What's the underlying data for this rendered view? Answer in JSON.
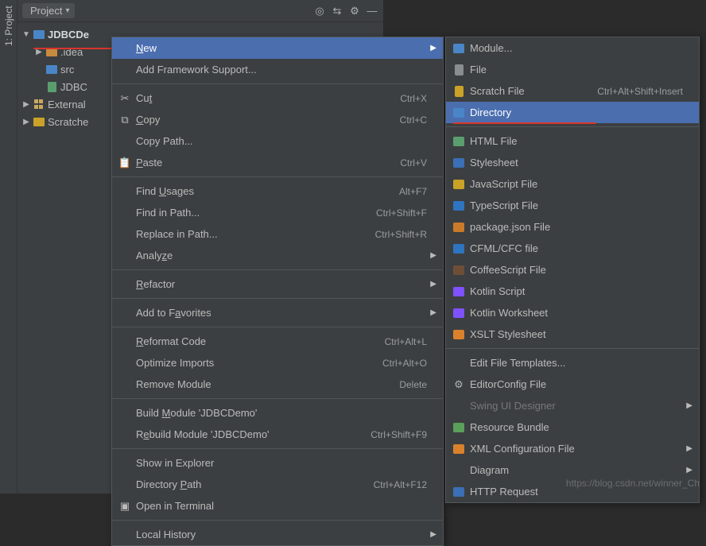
{
  "sidebar": {
    "tab_label": "1: Project"
  },
  "panel": {
    "title": "Project",
    "tree": {
      "root": "JDBCDe",
      "idea": ".idea",
      "src": "src",
      "jdbc": "JDBC",
      "external": "External",
      "scratches": "Scratche"
    }
  },
  "context_menu": {
    "new": "New",
    "add_framework": "Add Framework Support...",
    "cut": "Cut",
    "cut_sc": "Ctrl+X",
    "copy": "Copy",
    "copy_sc": "Ctrl+C",
    "copy_path": "Copy Path...",
    "paste": "Paste",
    "paste_sc": "Ctrl+V",
    "find_usages": "Find Usages",
    "find_usages_sc": "Alt+F7",
    "find_in_path": "Find in Path...",
    "find_in_path_sc": "Ctrl+Shift+F",
    "replace_in_path": "Replace in Path...",
    "replace_in_path_sc": "Ctrl+Shift+R",
    "analyze": "Analyze",
    "refactor": "Refactor",
    "favorites": "Add to Favorites",
    "reformat": "Reformat Code",
    "reformat_sc": "Ctrl+Alt+L",
    "optimize": "Optimize Imports",
    "optimize_sc": "Ctrl+Alt+O",
    "remove_module": "Remove Module",
    "remove_module_sc": "Delete",
    "build": "Build Module 'JDBCDemo'",
    "rebuild": "Rebuild Module 'JDBCDemo'",
    "rebuild_sc": "Ctrl+Shift+F9",
    "show_explorer": "Show in Explorer",
    "dir_path": "Directory Path",
    "dir_path_sc": "Ctrl+Alt+F12",
    "open_terminal": "Open in Terminal",
    "local_history": "Local History"
  },
  "submenu": {
    "module": "Module...",
    "file": "File",
    "scratch": "Scratch File",
    "scratch_sc": "Ctrl+Alt+Shift+Insert",
    "directory": "Directory",
    "html": "HTML File",
    "stylesheet": "Stylesheet",
    "js": "JavaScript File",
    "ts": "TypeScript File",
    "pkgjson": "package.json File",
    "cfml": "CFML/CFC file",
    "coffee": "CoffeeScript File",
    "kotlin_script": "Kotlin Script",
    "kotlin_ws": "Kotlin Worksheet",
    "xslt": "XSLT Stylesheet",
    "edit_templates": "Edit File Templates...",
    "editorconfig": "EditorConfig File",
    "swing": "Swing UI Designer",
    "resource_bundle": "Resource Bundle",
    "xml_config": "XML Configuration File",
    "diagram": "Diagram",
    "http": "HTTP Request"
  },
  "watermark": "https://blog.csdn.net/winner_Ch"
}
